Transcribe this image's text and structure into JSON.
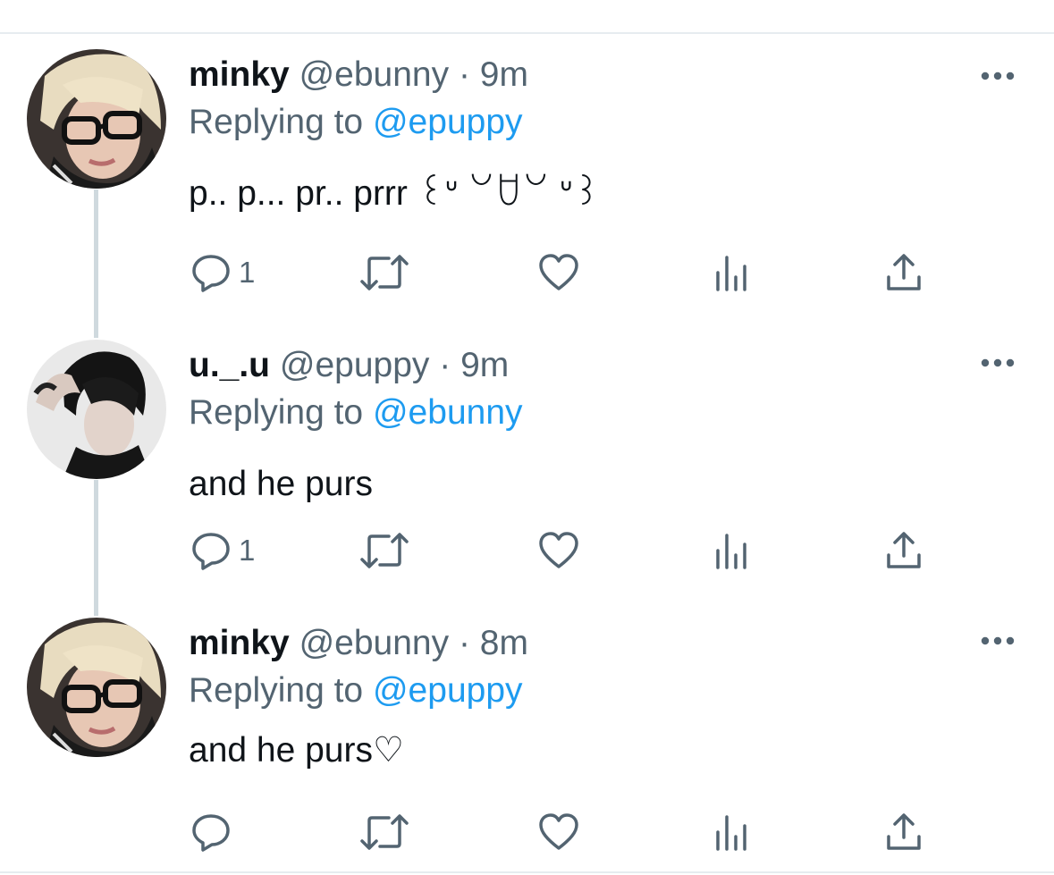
{
  "colors": {
    "accent": "#1d9bf0",
    "secondary_text": "#536471",
    "primary_text": "#0f1419",
    "thread_line": "#cfd9de"
  },
  "tweets": [
    {
      "name": "minky",
      "handle": "@ebunny",
      "separator": "·",
      "time": "9m",
      "replying_prefix": "Replying to",
      "replying_to": "@epuppy",
      "text": "p.. p... pr.. prrr ꒰ᐡ ꒡ꇴ꒡ ᐡ꒱",
      "reply_count": "1",
      "more_icon": "more-icon",
      "avatar": "blonde-glasses-avatar"
    },
    {
      "name": "u._.u",
      "handle": "@epuppy",
      "separator": "·",
      "time": "9m",
      "replying_prefix": "Replying to",
      "replying_to": "@ebunny",
      "text": "and he purs",
      "reply_count": "1",
      "more_icon": "more-icon",
      "avatar": "dark-hair-avatar"
    },
    {
      "name": "minky",
      "handle": "@ebunny",
      "separator": "·",
      "time": "8m",
      "replying_prefix": "Replying to",
      "replying_to": "@epuppy",
      "text": "and he purs♡",
      "reply_count": "",
      "more_icon": "more-icon",
      "avatar": "blonde-glasses-avatar"
    }
  ],
  "action_icons": [
    "reply-icon",
    "retweet-icon",
    "like-icon",
    "analytics-icon",
    "share-icon"
  ]
}
